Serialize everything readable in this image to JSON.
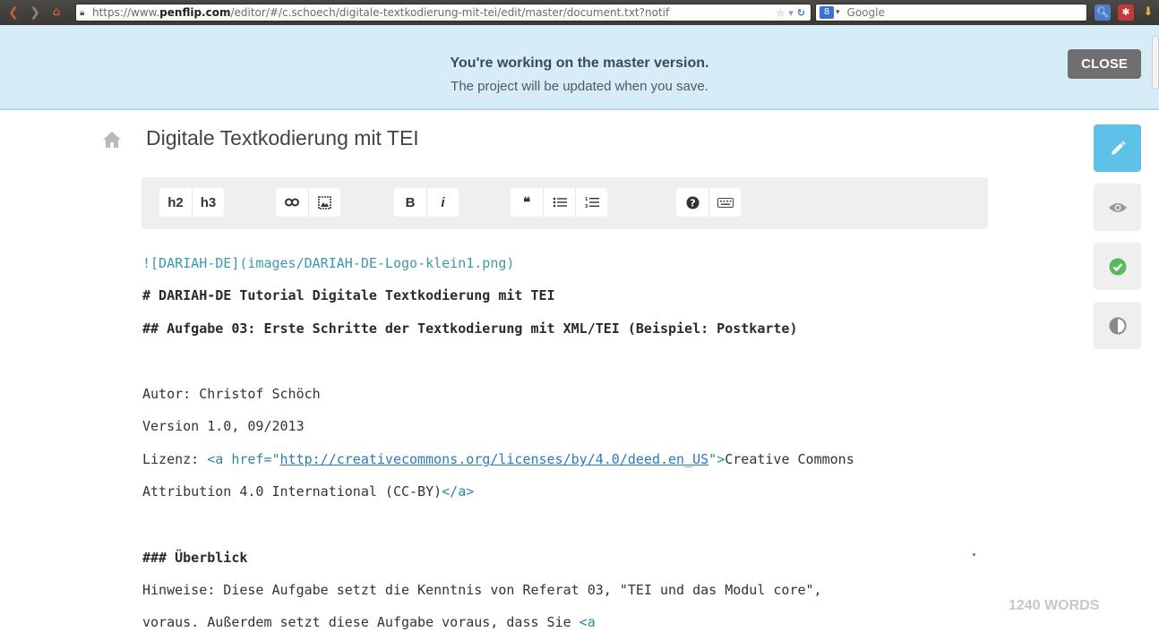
{
  "browser": {
    "url_prefix": "https://www.",
    "url_domain": "penflip.com",
    "url_path": "/editor/#/c.schoech/digitale-textkodierung-mit-tei/edit/master/document.txt?notif",
    "search_engine": "Google"
  },
  "banner": {
    "title": "You're working on the master version.",
    "subtitle": "The project will be updated when you save.",
    "close_label": "CLOSE"
  },
  "document": {
    "title": "Digitale Textkodierung mit TEI"
  },
  "toolbar": {
    "h2": "h2",
    "h3": "h3",
    "bold": "B",
    "italic": "i"
  },
  "editor": {
    "img_line": "![DARIAH-DE](images/DARIAH-DE-Logo-klein1.png)",
    "h1_line": "# DARIAH-DE Tutorial Digitale Textkodierung mit TEI",
    "h2_line": "## Aufgabe 03: Erste Schritte der Textkodierung mit XML/TEI (Beispiel: Postkarte)",
    "author_line": "Autor: Christof Schöch",
    "version_line": "Version 1.0, 09/2013",
    "license_prefix": "Lizenz: ",
    "license_tag_open": "<a ",
    "license_attr": "href",
    "license_eq_quote": "=\"",
    "license_url": "http://creativecommons.org/licenses/by/4.0/deed.en_US",
    "license_close_quote": "\">",
    "license_text": "Creative Commons",
    "license_line2_text": "Attribution 4.0 International (CC-BY)",
    "license_tag_close": "</a>",
    "h3_line": "### Überblick",
    "hint_line1": "Hinweise: Diese Aufgabe setzt die Kenntnis von Referat 03, \"TEI und das Modul core\",",
    "hint_line2_text": "voraus. Außerdem setzt diese Aufgabe voraus, dass Sie ",
    "hint_line2_tag": "<a"
  },
  "status": {
    "word_count": "1240 WORDS"
  },
  "colors": {
    "banner_bg": "#d6ecf6",
    "accent": "#5ec2e8",
    "success": "#5cb85c"
  }
}
